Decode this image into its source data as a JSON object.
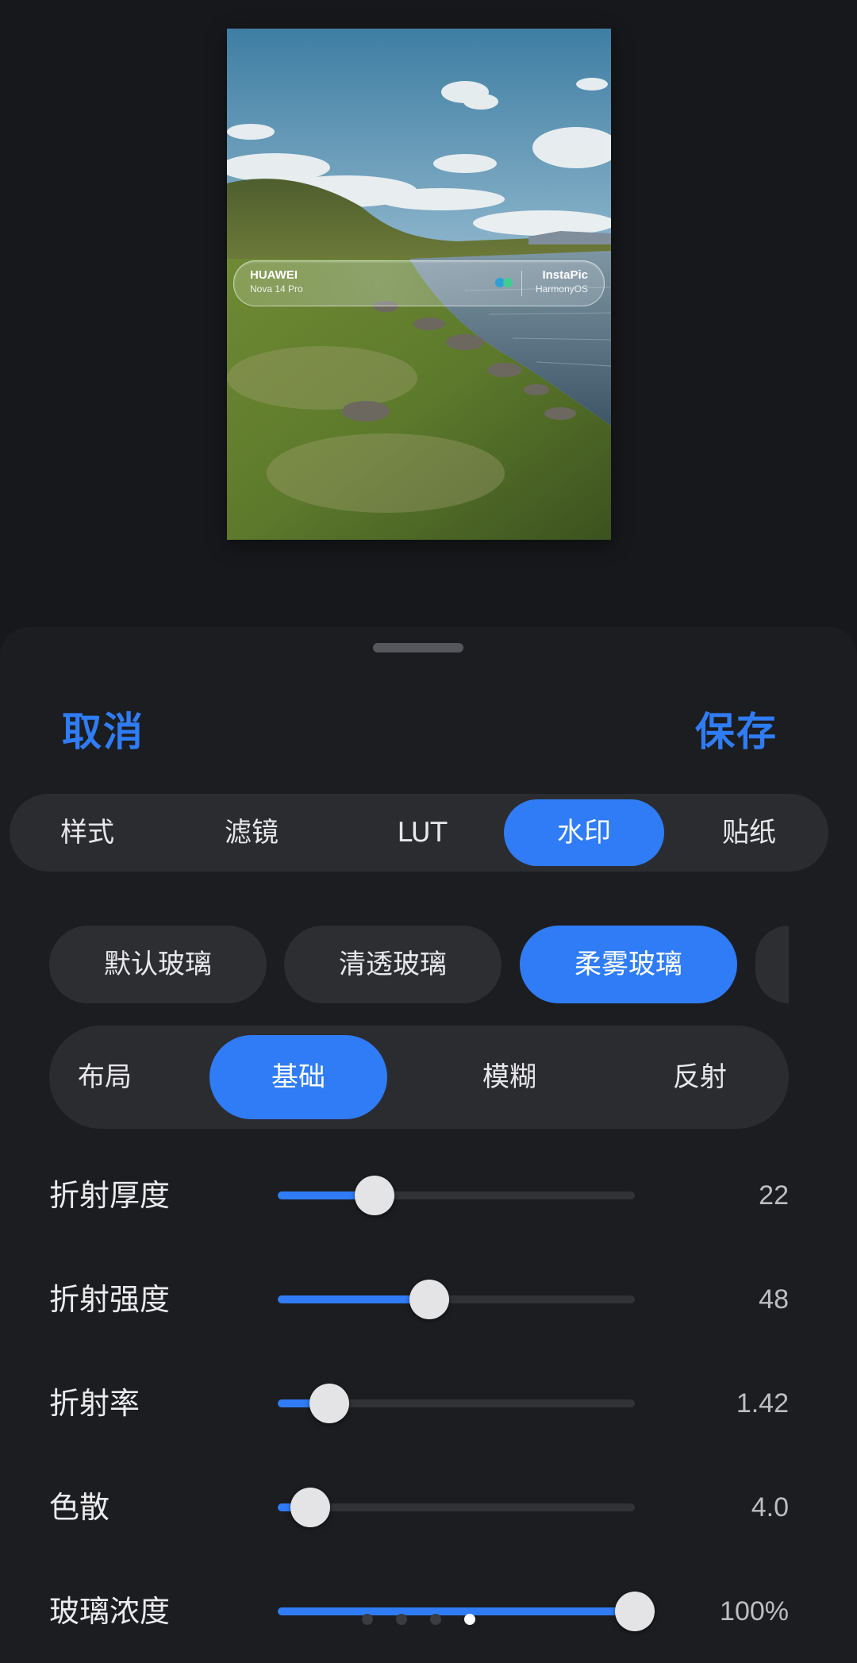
{
  "preview": {
    "watermark": {
      "brand": "HUAWEI",
      "model": "Nova 14 Pro",
      "app": "InstaPic",
      "os": "HarmonyOS"
    }
  },
  "header": {
    "cancel_label": "取消",
    "save_label": "保存"
  },
  "main_tabs": {
    "items": [
      "样式",
      "滤镜",
      "LUT",
      "水印",
      "贴纸"
    ],
    "active": "水印"
  },
  "presets": {
    "items": [
      "默认玻璃",
      "清透玻璃",
      "柔雾玻璃"
    ],
    "active": "柔雾玻璃"
  },
  "sub_tabs": {
    "items": [
      "布局",
      "基础",
      "模糊",
      "反射"
    ],
    "active": "基础"
  },
  "sliders": [
    {
      "label": "折射厚度",
      "value": "22",
      "fraction": 0.27
    },
    {
      "label": "折射强度",
      "value": "48",
      "fraction": 0.425
    },
    {
      "label": "折射率",
      "value": "1.42",
      "fraction": 0.145
    },
    {
      "label": "色散",
      "value": "4.0",
      "fraction": 0.09
    },
    {
      "label": "玻璃浓度",
      "value": "100%",
      "fraction": 1.0
    }
  ],
  "pager": {
    "count": 4,
    "active_index": 3
  },
  "colors": {
    "accent": "#2f7cf6",
    "background": "#17181b",
    "surface": "#2b2c30"
  }
}
